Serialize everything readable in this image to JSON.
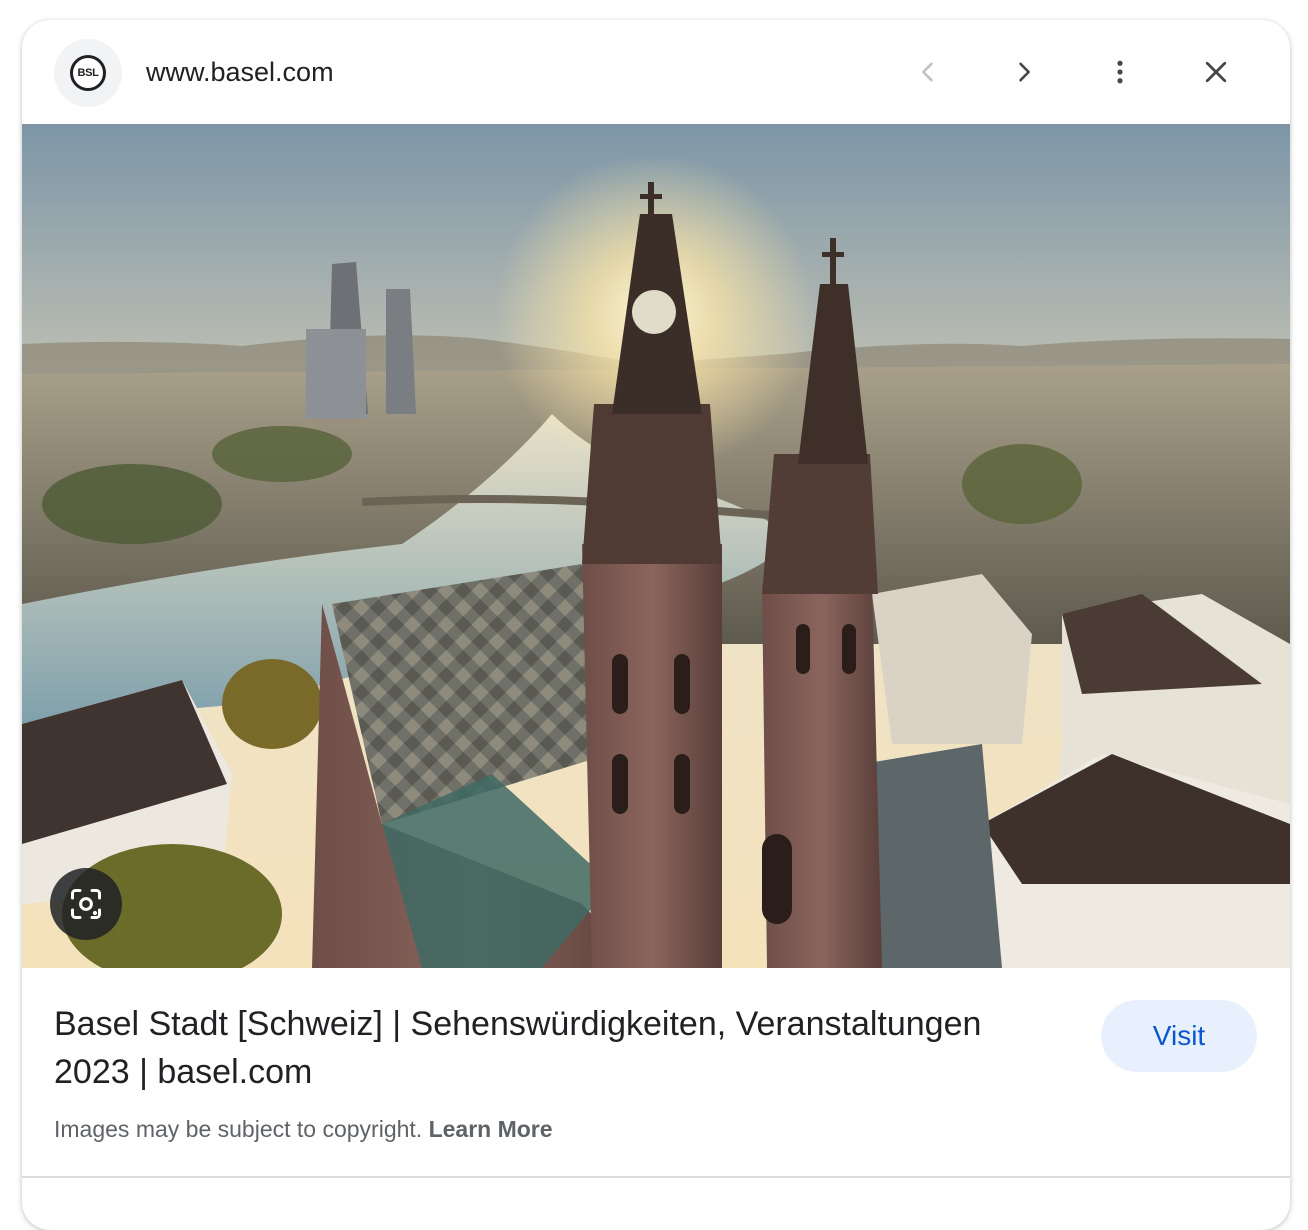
{
  "header": {
    "favicon_text": "BSL",
    "domain": "www.basel.com",
    "prev_icon": "chevron-left-icon",
    "next_icon": "chevron-right-icon",
    "more_icon": "more-vert-icon",
    "close_icon": "close-icon"
  },
  "image": {
    "lens_icon": "google-lens-icon"
  },
  "result": {
    "title": "Basel Stadt [Schweiz] | Sehenswürdigkeiten, Veranstaltungen 2023 | basel.com",
    "visit_label": "Visit"
  },
  "footer": {
    "copyright_text": "Images may be subject to copyright.",
    "learn_more_label": "Learn More"
  },
  "colors": {
    "visit_bg": "#e8f0fe",
    "visit_text": "#0b57d0",
    "text_primary": "#202124",
    "text_secondary": "#5f6368"
  }
}
